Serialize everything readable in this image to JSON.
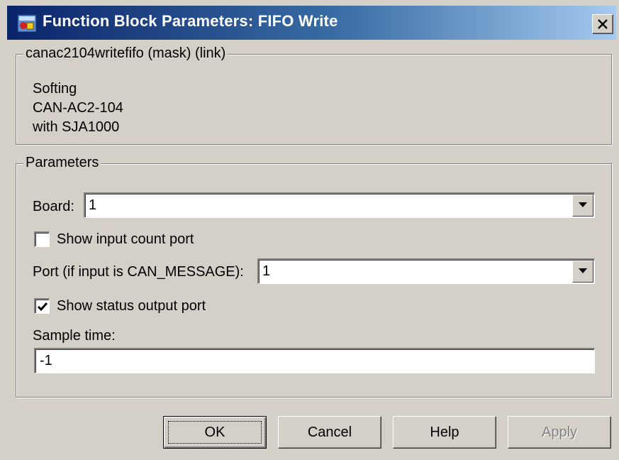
{
  "window": {
    "title": "Function Block Parameters: FIFO Write"
  },
  "description": {
    "legend": "canac2104writefifo (mask) (link)",
    "lines": [
      "Softing",
      "CAN-AC2-104",
      "with SJA1000"
    ]
  },
  "parameters": {
    "legend": "Parameters",
    "board": {
      "label": "Board:",
      "value": "1"
    },
    "show_input_count": {
      "label": "Show input count port",
      "checked": false
    },
    "port": {
      "label": "Port (if input is CAN_MESSAGE):",
      "value": "1"
    },
    "show_status_output": {
      "label": "Show status output port",
      "checked": true
    },
    "sample_time": {
      "label": "Sample time:",
      "value": "-1"
    }
  },
  "buttons": {
    "ok": "OK",
    "cancel": "Cancel",
    "help": "Help",
    "apply": "Apply"
  },
  "colors": {
    "title_gradient_start": "#0a246a",
    "title_gradient_end": "#a6caf0",
    "dialog_face": "#d4d0c8"
  },
  "icons": {
    "title": "simulink-block-icon",
    "close": "close-icon",
    "dropdown": "chevron-down-icon",
    "check": "checkmark-icon"
  }
}
